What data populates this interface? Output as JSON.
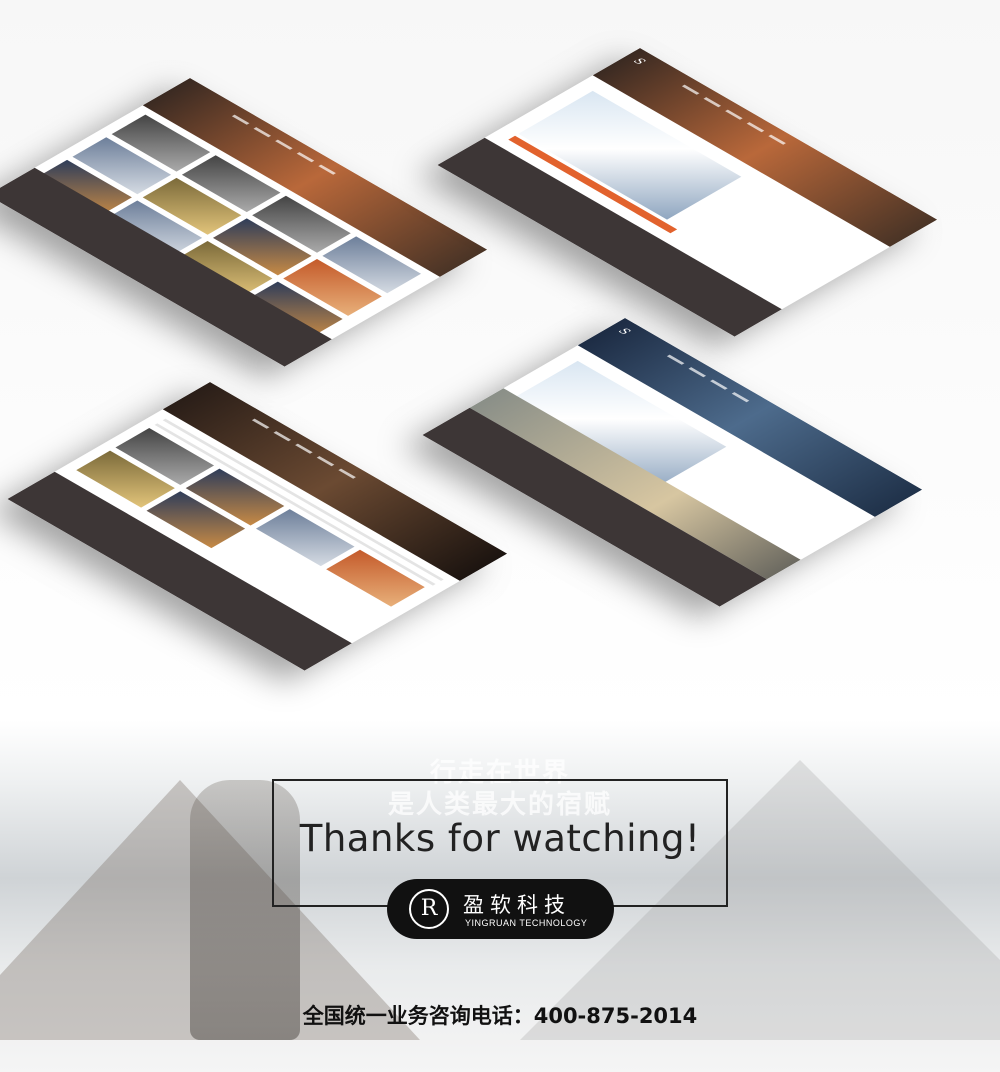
{
  "banner": {
    "ghost_line_1": "行走在世界",
    "ghost_line_2": "是人类最大的宿赋"
  },
  "thanks_text": "Thanks for watching!",
  "brand": {
    "logo_mark": "R",
    "name_cn": "盈软科技",
    "name_en": "YINGRUAN TECHNOLOGY"
  },
  "hotline": "全国统一业务咨询电话：400-875-2014",
  "mockups": [
    {
      "name": "mockup-gallery"
    },
    {
      "name": "mockup-article"
    },
    {
      "name": "mockup-services"
    },
    {
      "name": "mockup-about"
    }
  ],
  "colors": {
    "footer": "#3d3636",
    "accent": "#e2622d",
    "badge": "#111111"
  }
}
